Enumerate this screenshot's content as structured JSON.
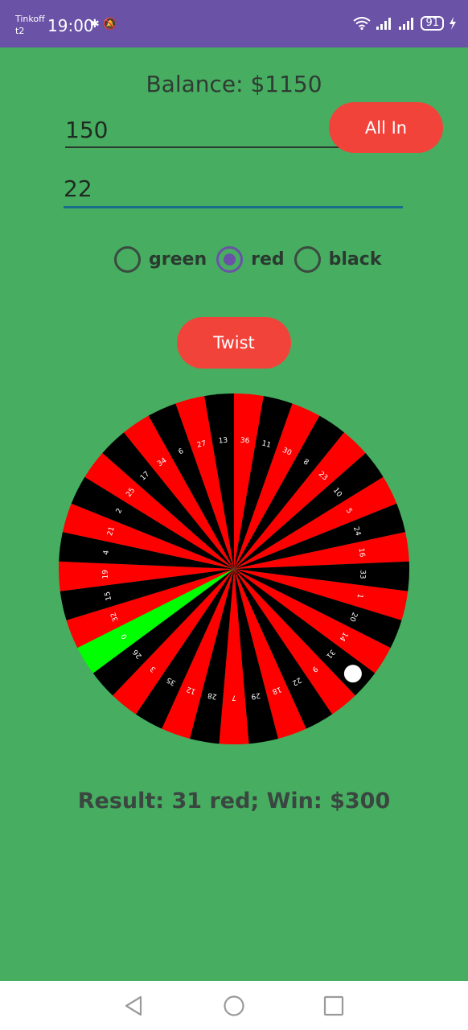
{
  "status_bar": {
    "carrier_line1": "Tinkoff",
    "carrier_line2": "t2",
    "time": "19:00",
    "left_icons": "✱ 🔕",
    "battery": "91"
  },
  "balance_text": "Balance: $1150",
  "bet_input": {
    "value": "150"
  },
  "number_input": {
    "value": "22"
  },
  "all_in_label": "All In",
  "radios": [
    {
      "label": "green",
      "checked": false
    },
    {
      "label": "red",
      "checked": true
    },
    {
      "label": "black",
      "checked": false
    }
  ],
  "twist_label": "Twist",
  "wheel": {
    "numbers_clockwise_from_top": [
      "36",
      "11",
      "30",
      "8",
      "23",
      "10",
      "5",
      "24",
      "16",
      "33",
      "1",
      "20",
      "14",
      "31",
      "9",
      "22",
      "18",
      "29",
      "7",
      "28",
      "12",
      "35",
      "3",
      "26",
      "0",
      "32",
      "15",
      "19",
      "4",
      "21",
      "2",
      "25",
      "17",
      "34",
      "6",
      "27",
      "13"
    ],
    "colors": {
      "red": "#fe0000",
      "black": "#000000",
      "green": "#00ff00"
    },
    "ball_on": "31"
  },
  "result_text": "Result: 31 red; Win: $300"
}
